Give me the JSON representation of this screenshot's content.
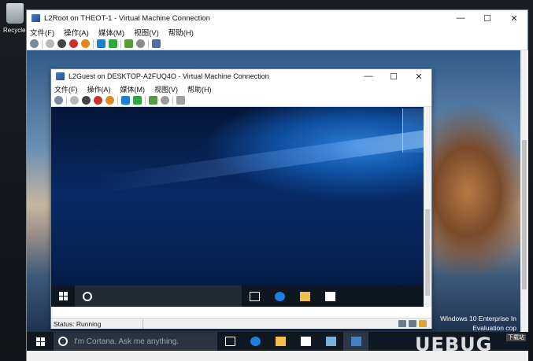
{
  "desktop": {
    "recycle_label": "Recycle"
  },
  "outer_window": {
    "title": "L2Root on THEOT-1 - Virtual Machine Connection",
    "menu": [
      "文件(F)",
      "操作(A)",
      "媒体(M)",
      "视图(V)",
      "帮助(H)"
    ],
    "controls": {
      "minimize": "—",
      "maximize": "☐",
      "close": "✕"
    }
  },
  "inner_window": {
    "title": "L2Guest on DESKTOP-A2FUQ4O - Virtual Machine Connection",
    "menu": [
      "文件(F)",
      "操作(A)",
      "媒体(M)",
      "视图(V)",
      "帮助(H)"
    ],
    "controls": {
      "minimize": "—",
      "maximize": "☐",
      "close": "✕"
    },
    "status": "Status: Running"
  },
  "outer_taskbar": {
    "cortana_placeholder": "I'm Cortana. Ask me anything."
  },
  "watermark_text": {
    "line1": "Windows 10 Enterprise In",
    "line2": "Evaluation cop"
  },
  "brand": {
    "logo_text": "UEBUG",
    "tag": "下载站"
  },
  "colors": {
    "taskbar": "#101822",
    "accent": "#1f6fd0"
  }
}
